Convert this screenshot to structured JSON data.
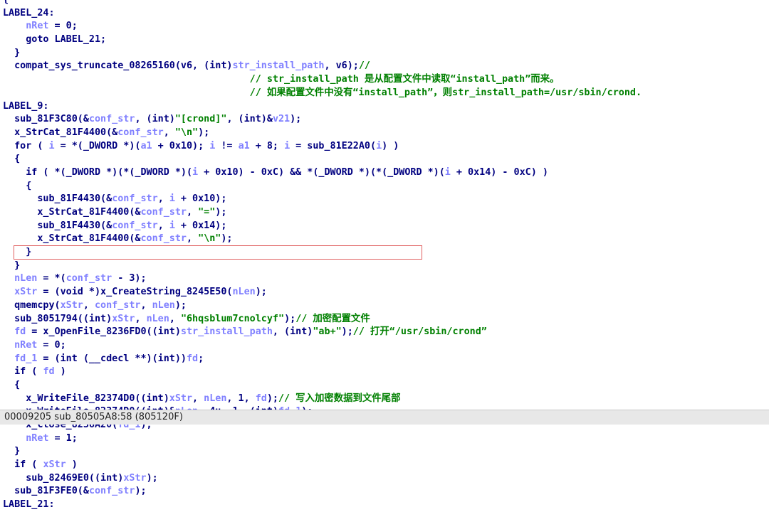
{
  "code_lines": [
    [
      {
        "t": "{",
        "c": "plain"
      }
    ],
    [
      {
        "t": "LABEL_24:",
        "c": "lbl"
      }
    ],
    [
      {
        "t": "    ",
        "c": "plain"
      },
      {
        "t": "nRet",
        "c": "var"
      },
      {
        "t": " = 0;",
        "c": "plain"
      }
    ],
    [
      {
        "t": "    goto LABEL_21;",
        "c": "plain"
      }
    ],
    [
      {
        "t": "  }",
        "c": "plain"
      }
    ],
    [
      {
        "t": "  compat_sys_truncate_08265160(v6, (int)",
        "c": "plain"
      },
      {
        "t": "str_install_path",
        "c": "var"
      },
      {
        "t": ", v6);",
        "c": "plain"
      },
      {
        "t": "//",
        "c": "cmt"
      }
    ],
    [
      {
        "t": "                                           // str_install_path 是从配置文件中读取“install_path”而来。",
        "c": "cmt"
      }
    ],
    [
      {
        "t": "                                           // 如果配置文件中没有“install_path”，则str_install_path=/usr/sbin/crond.",
        "c": "cmt"
      }
    ],
    [
      {
        "t": "LABEL_9:",
        "c": "lbl"
      }
    ],
    [
      {
        "t": "  sub_81F3C80(&",
        "c": "plain"
      },
      {
        "t": "conf_str",
        "c": "var"
      },
      {
        "t": ", (int)",
        "c": "plain"
      },
      {
        "t": "\"[crond]\"",
        "c": "str"
      },
      {
        "t": ", (int)&",
        "c": "plain"
      },
      {
        "t": "v21",
        "c": "var"
      },
      {
        "t": ");",
        "c": "plain"
      }
    ],
    [
      {
        "t": "  x_StrCat_81F4400(&",
        "c": "plain"
      },
      {
        "t": "conf_str",
        "c": "var"
      },
      {
        "t": ", ",
        "c": "plain"
      },
      {
        "t": "\"\\n\"",
        "c": "str"
      },
      {
        "t": ");",
        "c": "plain"
      }
    ],
    [
      {
        "t": "  for ( ",
        "c": "plain"
      },
      {
        "t": "i",
        "c": "var"
      },
      {
        "t": " = *(_DWORD *)(",
        "c": "plain"
      },
      {
        "t": "a1",
        "c": "var"
      },
      {
        "t": " + 0x10); ",
        "c": "plain"
      },
      {
        "t": "i",
        "c": "var"
      },
      {
        "t": " != ",
        "c": "plain"
      },
      {
        "t": "a1",
        "c": "var"
      },
      {
        "t": " + 8; ",
        "c": "plain"
      },
      {
        "t": "i",
        "c": "var"
      },
      {
        "t": " = sub_81E22A0(",
        "c": "plain"
      },
      {
        "t": "i",
        "c": "var"
      },
      {
        "t": ") )",
        "c": "plain"
      }
    ],
    [
      {
        "t": "  {",
        "c": "plain"
      }
    ],
    [
      {
        "t": "    if ( *(_DWORD *)(*(_DWORD *)(",
        "c": "plain"
      },
      {
        "t": "i",
        "c": "var"
      },
      {
        "t": " + 0x10) - 0xC) && *(_DWORD *)(*(_DWORD *)(",
        "c": "plain"
      },
      {
        "t": "i",
        "c": "var"
      },
      {
        "t": " + 0x14) - 0xC) )",
        "c": "plain"
      }
    ],
    [
      {
        "t": "    {",
        "c": "plain"
      }
    ],
    [
      {
        "t": "      sub_81F4430(&",
        "c": "plain"
      },
      {
        "t": "conf_str",
        "c": "var"
      },
      {
        "t": ", ",
        "c": "plain"
      },
      {
        "t": "i",
        "c": "var"
      },
      {
        "t": " + 0x10);",
        "c": "plain"
      }
    ],
    [
      {
        "t": "      x_StrCat_81F4400(&",
        "c": "plain"
      },
      {
        "t": "conf_str",
        "c": "var"
      },
      {
        "t": ", ",
        "c": "plain"
      },
      {
        "t": "\"=\"",
        "c": "str"
      },
      {
        "t": ");",
        "c": "plain"
      }
    ],
    [
      {
        "t": "      sub_81F4430(&",
        "c": "plain"
      },
      {
        "t": "conf_str",
        "c": "var"
      },
      {
        "t": ", ",
        "c": "plain"
      },
      {
        "t": "i",
        "c": "var"
      },
      {
        "t": " + 0x14);",
        "c": "plain"
      }
    ],
    [
      {
        "t": "      x_StrCat_81F4400(&",
        "c": "plain"
      },
      {
        "t": "conf_str",
        "c": "var"
      },
      {
        "t": ", ",
        "c": "plain"
      },
      {
        "t": "\"\\n\"",
        "c": "str"
      },
      {
        "t": ");",
        "c": "plain"
      }
    ],
    [
      {
        "t": "    }",
        "c": "plain"
      }
    ],
    [
      {
        "t": "  }",
        "c": "plain"
      }
    ],
    [
      {
        "t": "  ",
        "c": "plain"
      },
      {
        "t": "nLen",
        "c": "var"
      },
      {
        "t": " = *(",
        "c": "plain"
      },
      {
        "t": "conf_str",
        "c": "var"
      },
      {
        "t": " - 3);",
        "c": "plain"
      }
    ],
    [
      {
        "t": "  ",
        "c": "plain"
      },
      {
        "t": "xStr",
        "c": "var"
      },
      {
        "t": " = (void *)x_CreateString_8245E50(",
        "c": "plain"
      },
      {
        "t": "nLen",
        "c": "var"
      },
      {
        "t": ");",
        "c": "plain"
      }
    ],
    [
      {
        "t": "  qmemcpy(",
        "c": "plain"
      },
      {
        "t": "xStr",
        "c": "var"
      },
      {
        "t": ", ",
        "c": "plain"
      },
      {
        "t": "conf_str",
        "c": "var"
      },
      {
        "t": ", ",
        "c": "plain"
      },
      {
        "t": "nLen",
        "c": "var"
      },
      {
        "t": ");",
        "c": "plain"
      }
    ],
    [
      {
        "t": "  sub_8051794((int)",
        "c": "plain"
      },
      {
        "t": "xStr",
        "c": "var"
      },
      {
        "t": ", ",
        "c": "plain"
      },
      {
        "t": "nLen",
        "c": "var"
      },
      {
        "t": ", ",
        "c": "plain"
      },
      {
        "t": "\"6hqsblum7cnolcyf\"",
        "c": "str"
      },
      {
        "t": ");",
        "c": "plain"
      },
      {
        "t": "// 加密配置文件",
        "c": "cmt"
      }
    ],
    [
      {
        "t": "  ",
        "c": "plain"
      },
      {
        "t": "fd",
        "c": "var"
      },
      {
        "t": " = x_OpenFile_8236FD0((int)",
        "c": "plain"
      },
      {
        "t": "str_install_path",
        "c": "var"
      },
      {
        "t": ", (int)",
        "c": "plain"
      },
      {
        "t": "\"ab+\"",
        "c": "str"
      },
      {
        "t": ");",
        "c": "plain"
      },
      {
        "t": "// 打开“/usr/sbin/crond”",
        "c": "cmt"
      }
    ],
    [
      {
        "t": "  ",
        "c": "plain"
      },
      {
        "t": "nRet",
        "c": "var"
      },
      {
        "t": " = 0;",
        "c": "plain"
      }
    ],
    [
      {
        "t": "  ",
        "c": "plain"
      },
      {
        "t": "fd_1",
        "c": "var"
      },
      {
        "t": " = (int (__cdecl **)(int))",
        "c": "plain"
      },
      {
        "t": "fd",
        "c": "var"
      },
      {
        "t": ";",
        "c": "plain"
      }
    ],
    [
      {
        "t": "  if ( ",
        "c": "plain"
      },
      {
        "t": "fd",
        "c": "var"
      },
      {
        "t": " )",
        "c": "plain"
      }
    ],
    [
      {
        "t": "  {",
        "c": "plain"
      }
    ],
    [
      {
        "t": "    x_WriteFile_82374D0((int)",
        "c": "plain"
      },
      {
        "t": "xStr",
        "c": "var"
      },
      {
        "t": ", ",
        "c": "plain"
      },
      {
        "t": "nLen",
        "c": "var"
      },
      {
        "t": ", 1, ",
        "c": "plain"
      },
      {
        "t": "fd",
        "c": "var"
      },
      {
        "t": ");",
        "c": "plain"
      },
      {
        "t": "// 写入加密数据到文件尾部",
        "c": "cmt"
      }
    ],
    [
      {
        "t": "    x_WriteFile_82374D0((int)&",
        "c": "plain"
      },
      {
        "t": "nLen",
        "c": "var"
      },
      {
        "t": ", 4u, 1, (int)",
        "c": "plain"
      },
      {
        "t": "fd_1",
        "c": "var"
      },
      {
        "t": ");",
        "c": "plain"
      }
    ],
    [
      {
        "t": "    x_Close_8236A20(",
        "c": "plain"
      },
      {
        "t": "fd_1",
        "c": "var"
      },
      {
        "t": ");",
        "c": "plain"
      }
    ],
    [
      {
        "t": "    ",
        "c": "plain"
      },
      {
        "t": "nRet",
        "c": "var"
      },
      {
        "t": " = 1;",
        "c": "plain"
      }
    ],
    [
      {
        "t": "  }",
        "c": "plain"
      }
    ],
    [
      {
        "t": "  if ( ",
        "c": "plain"
      },
      {
        "t": "xStr",
        "c": "var"
      },
      {
        "t": " )",
        "c": "plain"
      }
    ],
    [
      {
        "t": "    sub_82469E0((int)",
        "c": "plain"
      },
      {
        "t": "xStr",
        "c": "var"
      },
      {
        "t": ");",
        "c": "plain"
      }
    ],
    [
      {
        "t": "  sub_81F3FE0(&",
        "c": "plain"
      },
      {
        "t": "conf_str",
        "c": "var"
      },
      {
        "t": ");",
        "c": "plain"
      }
    ],
    [
      {
        "t": "LABEL_21:",
        "c": "lbl"
      }
    ]
  ],
  "highlighted_line_index": 24,
  "status_bar": "00009205 sub_80505A8:58 (805120F)",
  "colors": {
    "keyword_plain": "#000080",
    "variable": "#8080ff",
    "string": "#008000",
    "comment": "#008000",
    "highlight_border": "#e06060"
  }
}
